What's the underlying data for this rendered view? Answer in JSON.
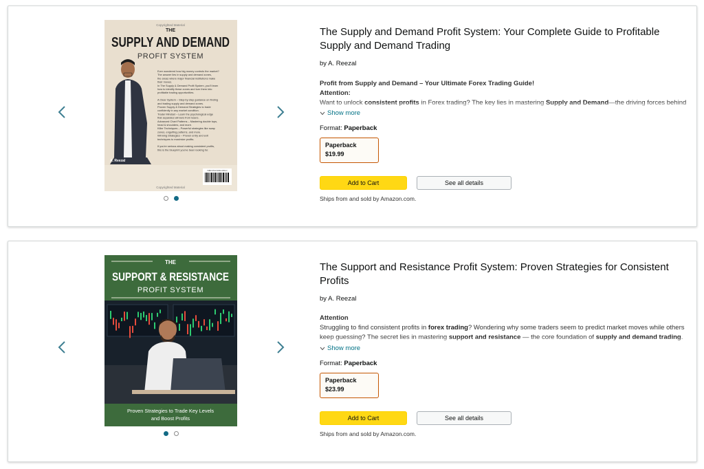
{
  "products": [
    {
      "title": "The Supply and Demand Profit System: Your Complete Guide to Profitable Supply and Demand Trading",
      "author": "by A. Reezal",
      "desc_lead": "Profit from Supply and Demand – Your Ultimate Forex Trading Guide!",
      "desc_attention": "Attention:",
      "desc_p1": "Want to unlock ",
      "desc_b1": "consistent profits",
      "desc_p2": " in Forex trading? The key lies in mastering ",
      "desc_b2": "Supply and Demand",
      "desc_p3": "—the driving forces behind market movement.",
      "show_more": "Show more",
      "format_label": "Format: ",
      "format_value": "Paperback",
      "option_label": "Paperback",
      "option_price": "$19.99",
      "add_to_cart": "Add to Cart",
      "see_details": "See all details",
      "ships": "Ships from and sold by Amazon.com.",
      "cover": {
        "top_note": "Copyrighted Material",
        "title_line1": "THE",
        "title_line2": "SUPPLY AND DEMAND",
        "title_line3": "PROFIT SYSTEM",
        "author": "A. Reezal",
        "bottom_note": "Copyrighted Material",
        "isbn": "ISBN 979-8-3062-2302-3",
        "back_text": [
          "Ever wondered how big money controls the market?",
          "The answer lies in supply and demand zones,",
          "the areas where major financial institutions make",
          "their moves.",
          "In The Supply & Demand Profit System, you'll learn",
          "how to identify these zones and turn them into",
          "profitable trading opportunities.",
          "",
          "A Clear System – Step-by-step guidance on finding",
          "and trading supply and demand zones.",
          "Proven Supply & Demand Strategies to trade",
          "confidently in any market condition.",
          "Trader Mindset – Learn the psychological edge",
          "that separates winners from losers.",
          "Advanced Chart Patterns – Mastering double tops,",
          "head & shoulders, and more.",
          "Killer Techniques – Powerful strategies like swap",
          "zones, engulfing patterns, and more.",
          "Winning Strategies – Proven entry and exit",
          "techniques to maximize profits.",
          "",
          "If you're serious about making consistent profits,",
          "this is the blueprint you've been looking for."
        ]
      }
    },
    {
      "title": "The Support and Resistance Profit System: Proven Strategies for Consistent Profits",
      "author": "by A. Reezal",
      "desc_attention": "Attention",
      "desc_p1": "Struggling to find consistent profits in ",
      "desc_b1": "forex trading",
      "desc_p2": "? Wondering why some traders seem to predict market moves while others keep guessing? The secret lies in mastering ",
      "desc_b2": "support and resistance",
      "desc_p3": " — the core foundation of ",
      "desc_b3": "supply and demand trading",
      "desc_p4": ".",
      "show_more": "Show more",
      "format_label": "Format: ",
      "format_value": "Paperback",
      "option_label": "Paperback",
      "option_price": "$23.99",
      "add_to_cart": "Add to Cart",
      "see_details": "See all details",
      "ships": "Ships from and sold by Amazon.com.",
      "cover": {
        "title_line1": "THE",
        "title_line2": "SUPPORT & RESISTANCE",
        "title_line3": "PROFIT SYSTEM",
        "subtitle_line1": "Proven Strategies to Trade Key Levels",
        "subtitle_line2": "and Boost Profits"
      }
    }
  ],
  "colors": {
    "accent_link": "#007185",
    "cart_button": "#ffd814",
    "selected_border": "#c45500",
    "active_dot": "#136a85",
    "cover1_bg": "#e9dfcf",
    "cover2_bg": "#3d6b3c"
  }
}
